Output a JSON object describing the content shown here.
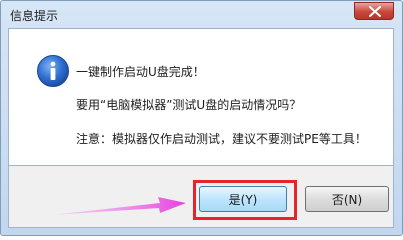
{
  "window": {
    "title": "信息提示"
  },
  "message": {
    "line1": "一键制作启动U盘完成！",
    "line2": "要用“电脑模拟器”测试U盘的启动情况吗？",
    "line3": "注意：模拟器仅作启动测试，建议不要测试PE等工具！"
  },
  "buttons": {
    "yes_label": "是(Y)",
    "no_label": "否(N)"
  },
  "colors": {
    "highlight": "#e8232a",
    "arrow": "#e83fe0"
  }
}
